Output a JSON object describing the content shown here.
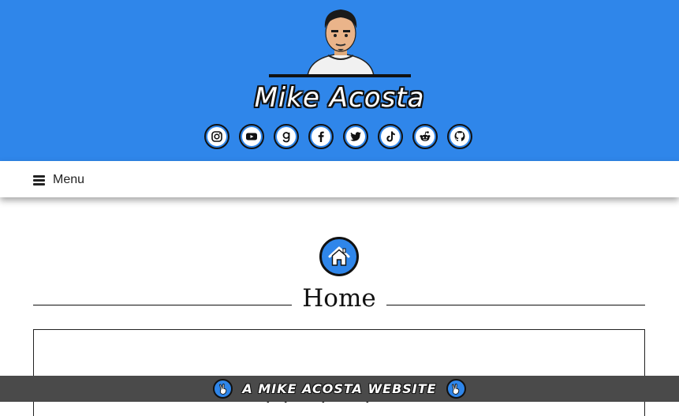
{
  "header": {
    "site_title": "Mike Acosta",
    "background_color": "#2f86ea"
  },
  "socials": [
    {
      "name": "instagram",
      "icon": "instagram-icon"
    },
    {
      "name": "youtube",
      "icon": "youtube-icon"
    },
    {
      "name": "goodreads",
      "icon": "goodreads-icon"
    },
    {
      "name": "facebook",
      "icon": "facebook-icon"
    },
    {
      "name": "twitter",
      "icon": "twitter-icon"
    },
    {
      "name": "tiktok",
      "icon": "tiktok-icon"
    },
    {
      "name": "reddit",
      "icon": "reddit-icon"
    },
    {
      "name": "github",
      "icon": "github-icon"
    }
  ],
  "nav": {
    "menu_label": "Menu",
    "menu_icon": "hamburger-icon"
  },
  "main": {
    "page_icon": "home-icon",
    "page_title": "Home"
  },
  "footer": {
    "text": "A MIKE ACOSTA WEBSITE",
    "icon": "peace-hand-icon",
    "background_color": "#4a4a4a"
  }
}
